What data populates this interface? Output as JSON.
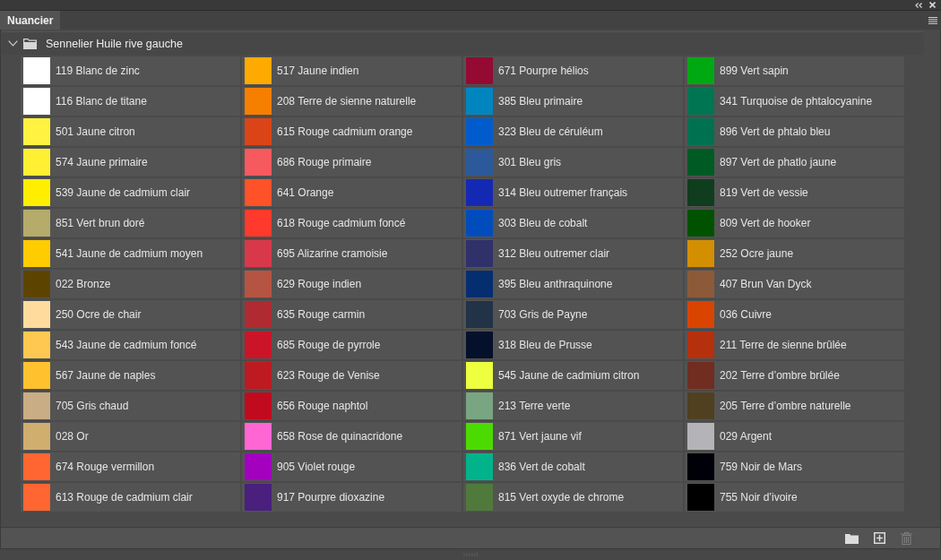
{
  "tabs": [
    {
      "label": "Nuancier",
      "selected": true
    }
  ],
  "group": {
    "name": "Sennelier Huile rive gauche",
    "expanded": true,
    "swatches": [
      {
        "name": "119 Blanc de zinc",
        "color": "#ffffff"
      },
      {
        "name": "116 Blanc de titane",
        "color": "#ffffff"
      },
      {
        "name": "501 Jaune citron",
        "color": "#fff240"
      },
      {
        "name": "574 Jaune primaire",
        "color": "#fff033"
      },
      {
        "name": "539 Jaune de cadmium clair",
        "color": "#ffee00"
      },
      {
        "name": "851 Vert brun doré",
        "color": "#b5ab6a"
      },
      {
        "name": "541 Jaune de cadmium moyen",
        "color": "#ffcc00"
      },
      {
        "name": "022 Bronze",
        "color": "#5c4400"
      },
      {
        "name": "250 Ocre de chair",
        "color": "#ffdc9e"
      },
      {
        "name": "543 Jaune de cadmium foncé",
        "color": "#ffc850"
      },
      {
        "name": "567 Jaune de naples",
        "color": "#ffc22e"
      },
      {
        "name": "705 Gris chaud",
        "color": "#c9ad85"
      },
      {
        "name": "028 Or",
        "color": "#cfae6e"
      },
      {
        "name": "674 Rouge vermillon",
        "color": "#ff6630"
      },
      {
        "name": "613 Rouge de cadmium clair",
        "color": "#ff6631"
      },
      {
        "name": "517 Jaune indien",
        "color": "#ffaa00"
      },
      {
        "name": "208 Terre de sienne naturelle",
        "color": "#f77f00"
      },
      {
        "name": "615 Rouge cadmium orange",
        "color": "#db4417"
      },
      {
        "name": "686 Rouge primaire",
        "color": "#f75a5e"
      },
      {
        "name": "641 Orange",
        "color": "#ff5228"
      },
      {
        "name": "618 Rouge cadmium foncé",
        "color": "#ff3a2d"
      },
      {
        "name": "695 Alizarine cramoisie",
        "color": "#d9384a"
      },
      {
        "name": "629 Rouge indien",
        "color": "#b55442"
      },
      {
        "name": "635 Rouge carmin",
        "color": "#b02b31"
      },
      {
        "name": "685 Rouge de pyrrole",
        "color": "#cc1428"
      },
      {
        "name": "623 Rouge de Venise",
        "color": "#bd1a22"
      },
      {
        "name": "656 Rouge naphtol",
        "color": "#c20a1e"
      },
      {
        "name": "658 Rose de quinacridone",
        "color": "#ff66d4"
      },
      {
        "name": "905 Violet rouge",
        "color": "#a300bf"
      },
      {
        "name": "917 Pourpre dioxazine",
        "color": "#4a1f7d"
      },
      {
        "name": "671 Pourpre hélios",
        "color": "#940a33"
      },
      {
        "name": "385 Bleu primaire",
        "color": "#0085bf"
      },
      {
        "name": "323 Bleu de céruléum",
        "color": "#005ccc"
      },
      {
        "name": "301 Bleu gris",
        "color": "#2b5999"
      },
      {
        "name": "314 Bleu outremer français",
        "color": "#1429b3"
      },
      {
        "name": "303 Bleu de cobalt",
        "color": "#004cbd"
      },
      {
        "name": "312 Bleu outremer clair",
        "color": "#30306b"
      },
      {
        "name": "395 Bleu anthraquinone",
        "color": "#052e70"
      },
      {
        "name": "703 Gris de Payne",
        "color": "#223247"
      },
      {
        "name": "318 Bleu de Prusse",
        "color": "#05102b"
      },
      {
        "name": "545 Jaune de cadmium citron",
        "color": "#eeff40"
      },
      {
        "name": "213 Terre verte",
        "color": "#7aa582"
      },
      {
        "name": "871 Vert jaune vif",
        "color": "#4cdb00"
      },
      {
        "name": "836 Vert de cobalt",
        "color": "#00b38a"
      },
      {
        "name": "815 Vert oxyde de chrome",
        "color": "#507a3c"
      },
      {
        "name": "899 Vert sapin",
        "color": "#00a812"
      },
      {
        "name": "341 Turquoise de phtalocyanine",
        "color": "#007552"
      },
      {
        "name": "896 Vert de phtalo bleu",
        "color": "#007150"
      },
      {
        "name": "897 Vert de phatlo jaune",
        "color": "#005a24"
      },
      {
        "name": "819 Vert de vessie",
        "color": "#0f3d1e"
      },
      {
        "name": "809 Vert de hooker",
        "color": "#005200"
      },
      {
        "name": "252 Ocre jaune",
        "color": "#d48f00"
      },
      {
        "name": "407 Brun Van Dyck",
        "color": "#8c5a38"
      },
      {
        "name": "036 Cuivre",
        "color": "#d94400"
      },
      {
        "name": "211 Terre de sienne brûlée",
        "color": "#b5300d"
      },
      {
        "name": "202 Terre d’ombre brûlée",
        "color": "#702d20"
      },
      {
        "name": "205 Terre d’ombre naturelle",
        "color": "#4f4020"
      },
      {
        "name": "029 Argent",
        "color": "#b4b4b8"
      },
      {
        "name": "759 Noir de Mars",
        "color": "#000008"
      },
      {
        "name": "755 Noir d’ivoire",
        "color": "#000000"
      }
    ]
  },
  "footer_tools": [
    {
      "kind": "new-group",
      "disabled": false
    },
    {
      "kind": "new-swatch",
      "disabled": false
    },
    {
      "kind": "delete",
      "disabled": true
    }
  ]
}
